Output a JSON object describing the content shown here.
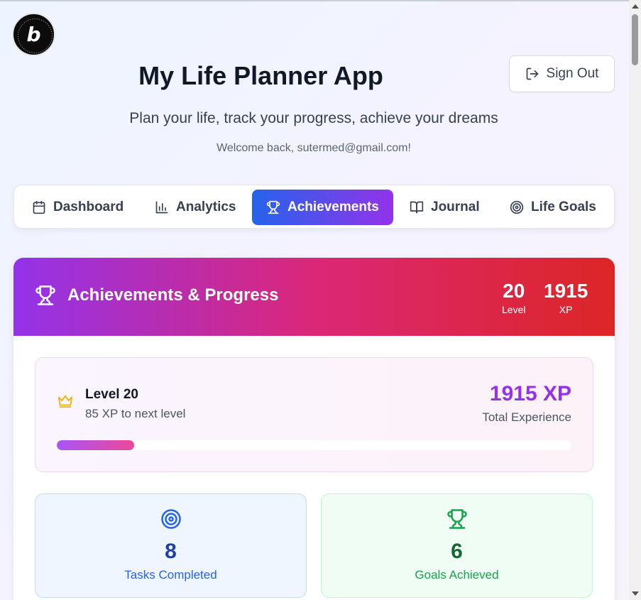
{
  "app": {
    "title": "My Life Planner App",
    "tagline": "Plan your life, track your progress, achieve your dreams",
    "welcome": "Welcome back, sutermed@gmail.com!",
    "sign_out_label": "Sign Out",
    "badge_letter": "b"
  },
  "nav": {
    "tabs": [
      {
        "label": "Dashboard",
        "icon": "calendar-icon",
        "active": false
      },
      {
        "label": "Analytics",
        "icon": "bar-chart-icon",
        "active": false
      },
      {
        "label": "Achievements",
        "icon": "trophy-icon",
        "active": true
      },
      {
        "label": "Journal",
        "icon": "book-open-icon",
        "active": false
      },
      {
        "label": "Life Goals",
        "icon": "target-icon",
        "active": false
      }
    ]
  },
  "achievements": {
    "title": "Achievements & Progress",
    "level_value": "20",
    "level_label": "Level",
    "xp_value": "1915",
    "xp_label": "XP",
    "level_card": {
      "title": "Level 20",
      "subtitle": "85 XP to next level",
      "total_xp": "1915 XP",
      "total_label": "Total Experience",
      "progress_fraction": 0.15
    },
    "stats": [
      {
        "value": "8",
        "label": "Tasks Completed",
        "icon": "target-icon",
        "color": "#2563eb"
      },
      {
        "value": "6",
        "label": "Goals Achieved",
        "icon": "trophy-icon",
        "color": "#16a34a"
      }
    ]
  },
  "colors": {
    "accent_blue": "#2563eb",
    "accent_purple": "#9333ea",
    "accent_pink": "#db2777",
    "accent_red": "#dc2626"
  }
}
